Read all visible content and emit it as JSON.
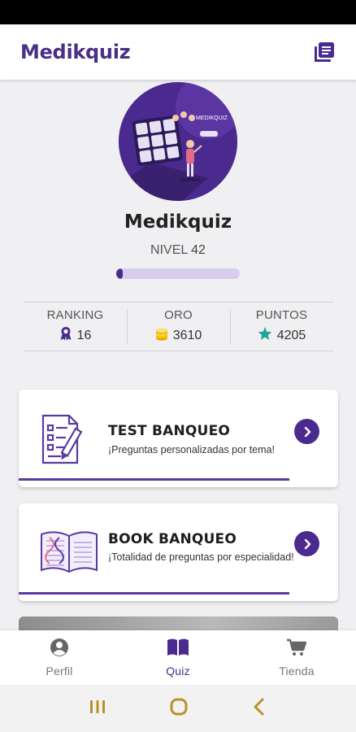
{
  "app": {
    "title": "Medikquiz"
  },
  "profile": {
    "name": "Medikquiz",
    "level_label": "NIVEL",
    "level_value": "42",
    "level_progress_fraction": 0.05
  },
  "stats": [
    {
      "label": "RANKING",
      "value": "16",
      "icon": "ribbon-icon"
    },
    {
      "label": "ORO",
      "value": "3610",
      "icon": "coins-icon"
    },
    {
      "label": "PUNTOS",
      "value": "4205",
      "icon": "star-icon"
    }
  ],
  "cards": [
    {
      "title": "TEST BANQUEO",
      "subtitle": "¡Preguntas personalizadas por tema!",
      "icon": "checklist-pencil-icon"
    },
    {
      "title": "BOOK BANQUEO",
      "subtitle": "¡Totalidad de preguntas por especialidad!",
      "icon": "dna-book-icon"
    }
  ],
  "bottom_nav": [
    {
      "label": "Perfil",
      "icon": "user-circle-icon",
      "active": false
    },
    {
      "label": "Quiz",
      "icon": "open-book-icon",
      "active": true
    },
    {
      "label": "Tienda",
      "icon": "cart-icon",
      "active": false
    }
  ],
  "colors": {
    "primary": "#4b2a8f",
    "progress_track": "#d9cdee",
    "coin": "#f2c20d",
    "star": "#1fa59a",
    "background": "#f0eff2"
  }
}
